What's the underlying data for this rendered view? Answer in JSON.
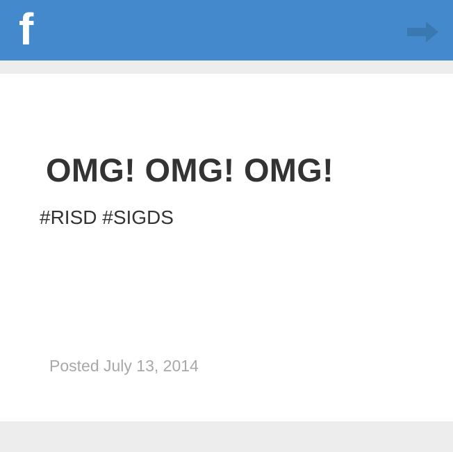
{
  "header": {
    "logo": "f",
    "logo_icon": "facebook-logo-icon",
    "next_icon": "arrow-right-icon",
    "background_color": "#4389cb"
  },
  "post": {
    "title": "OMG! OMG! OMG!",
    "tags": "#RISD #SIGDS",
    "date": "Posted July 13, 2014"
  },
  "colors": {
    "page_background": "#ededed",
    "card_background": "#ffffff",
    "text": "#333333",
    "muted_text": "#a8a8a8",
    "arrow": "#3a78b2"
  }
}
